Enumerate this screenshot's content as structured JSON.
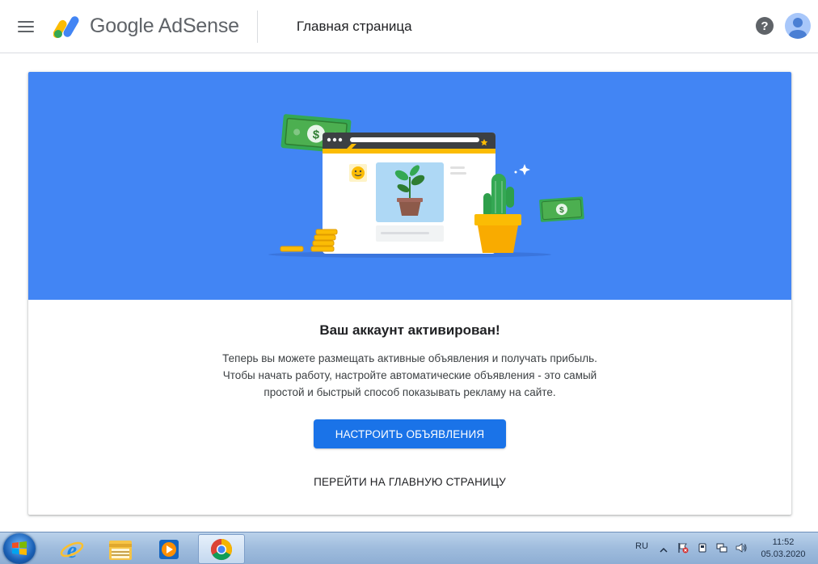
{
  "appbar": {
    "brand": "Google AdSense",
    "page_title": "Главная страница",
    "help_symbol": "?"
  },
  "card": {
    "title": "Ваш аккаунт активирован!",
    "body_lines": [
      "Теперь вы можете размещать активные объявления и получать прибыль.",
      "Чтобы начать работу, настройте автоматические объявления - это самый",
      "простой и быстрый способ показывать рекламу на сайте."
    ],
    "primary_button": "НАСТРОИТЬ ОБЪЯВЛЕНИЯ",
    "secondary_button": "ПЕРЕЙТИ НА ГЛАВНУЮ СТРАНИЦУ"
  },
  "taskbar": {
    "language": "RU",
    "time": "11:52",
    "date": "05.03.2020",
    "apps": [
      "internet-explorer-icon",
      "file-explorer-icon",
      "media-player-icon",
      "chrome-icon"
    ],
    "active_app": "chrome-icon"
  },
  "colors": {
    "hero_bg": "#4285f4",
    "primary": "#1a73e8",
    "money_green": "#34a853",
    "coin_gold": "#fbbc04"
  }
}
